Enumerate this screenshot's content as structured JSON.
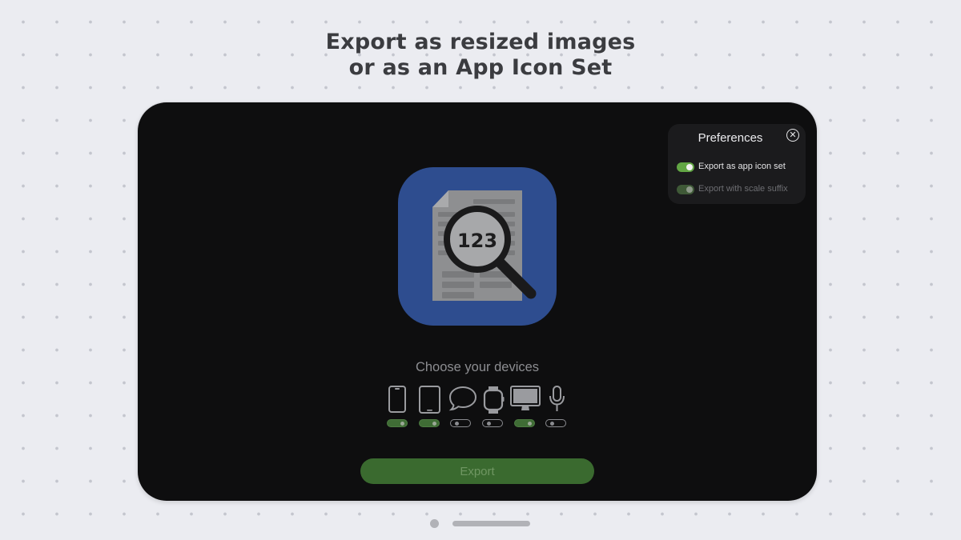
{
  "headline": {
    "line1": "Export as resized images",
    "line2": "or as an App Icon Set"
  },
  "preferences": {
    "title": "Preferences",
    "close_icon": "close-circle-icon",
    "options": [
      {
        "label": "Export as app icon set",
        "enabled": true
      },
      {
        "label": "Export with scale suffix",
        "enabled": false
      }
    ]
  },
  "app_icon": {
    "badge_text": "123",
    "icon": "document-magnifier-icon"
  },
  "devices": {
    "heading": "Choose your devices",
    "items": [
      {
        "icon": "iphone-icon",
        "enabled": true
      },
      {
        "icon": "ipad-icon",
        "enabled": true
      },
      {
        "icon": "imessage-bubble-icon",
        "enabled": false
      },
      {
        "icon": "apple-watch-icon",
        "enabled": false
      },
      {
        "icon": "mac-display-icon",
        "enabled": true
      },
      {
        "icon": "microphone-icon",
        "enabled": false
      }
    ]
  },
  "export_button": {
    "label": "Export"
  },
  "colors": {
    "accent_green": "#62a644",
    "app_icon_blue": "#2e4d8f",
    "device_bg": "#0e0e0f"
  }
}
